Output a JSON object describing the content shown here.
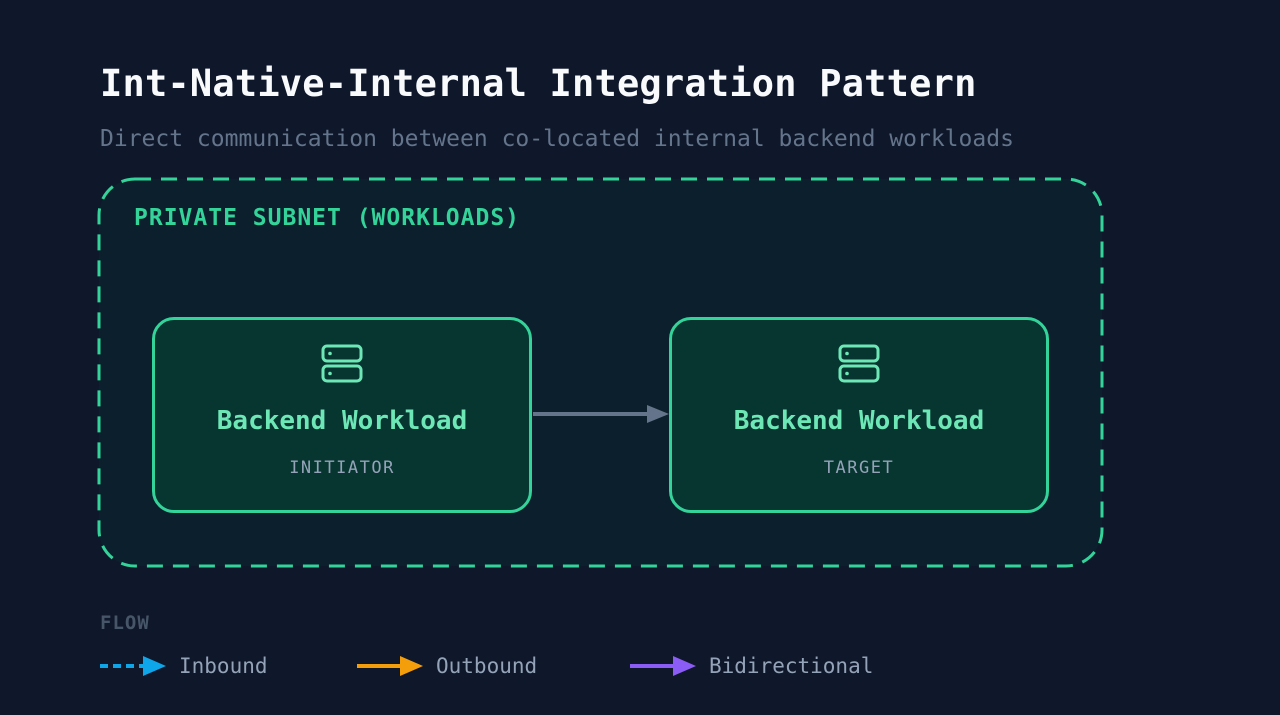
{
  "header": {
    "title": "Int-Native-Internal Integration Pattern",
    "subtitle": "Direct communication between co-located internal backend workloads"
  },
  "subnet": {
    "label": "PRIVATE SUBNET (WORKLOADS)",
    "color": "#34d399"
  },
  "nodes": [
    {
      "name": "Backend Workload",
      "role": "INITIATOR",
      "icon": "server-icon"
    },
    {
      "name": "Backend Workload",
      "role": "TARGET",
      "icon": "server-icon"
    }
  ],
  "connector": {
    "from": "INITIATOR",
    "to": "TARGET",
    "color": "#64748b"
  },
  "legend": {
    "title": "FLOW",
    "items": [
      {
        "label": "Inbound",
        "color": "#0ea5e9",
        "style": "dashed"
      },
      {
        "label": "Outbound",
        "color": "#f59e0b",
        "style": "solid"
      },
      {
        "label": "Bidirectional",
        "color": "#8b5cf6",
        "style": "solid"
      }
    ]
  },
  "colors": {
    "background": "#0f172a",
    "node_fill": "#073530",
    "node_border": "#34d399",
    "node_text": "#6ee7b7"
  }
}
